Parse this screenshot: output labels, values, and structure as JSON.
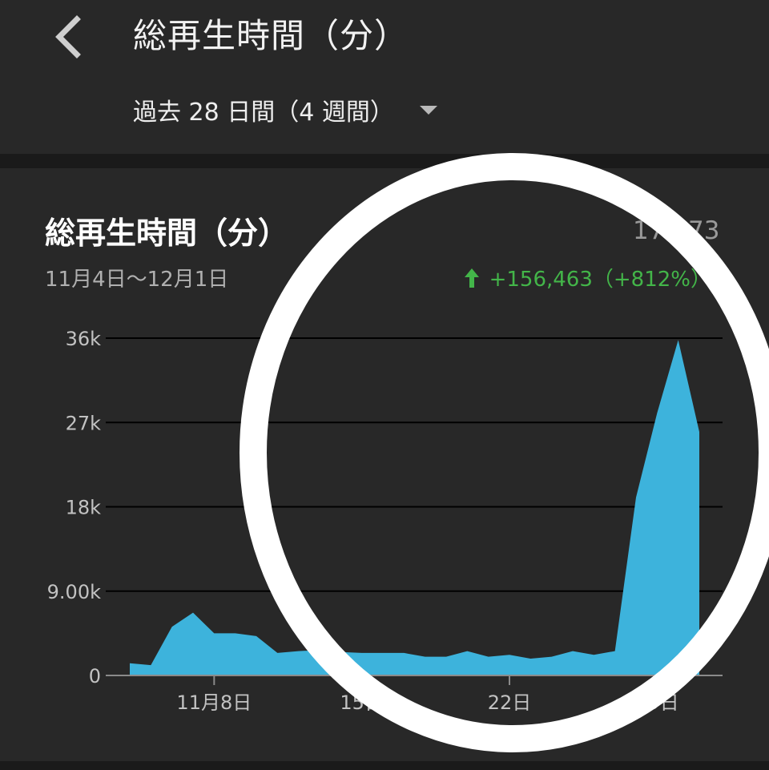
{
  "header": {
    "title": "総再生時間（分）",
    "range_label": "過去 28 日間（4 週間）"
  },
  "card": {
    "title": "総再生時間（分）",
    "total_visible": "175,73",
    "date_range": "11月4日〜12月1日",
    "delta": "+156,463（+812%）"
  },
  "colors": {
    "accent_area": "#3db3dc",
    "positive": "#43b549",
    "highlight_ring": "#ffffff"
  },
  "icons": {
    "back": "chevron-left-icon",
    "dropdown": "caret-down-icon",
    "delta": "arrow-up-icon"
  },
  "chart_data": {
    "type": "area",
    "x_start_label": "11月4日",
    "x_end_label": "12月1日",
    "x_tick_labels": [
      "11月8日",
      "15日",
      "22日",
      "29日"
    ],
    "x_tick_days": [
      8,
      15,
      22,
      29
    ],
    "y_tick_labels": [
      "0",
      "9.00k",
      "18k",
      "27k",
      "36k"
    ],
    "y_tick_values": [
      0,
      9000,
      18000,
      27000,
      36000
    ],
    "ylim": [
      0,
      36000
    ],
    "grid": true,
    "x": [
      4,
      5,
      6,
      7,
      8,
      9,
      10,
      11,
      12,
      13,
      14,
      15,
      16,
      17,
      18,
      19,
      20,
      21,
      22,
      23,
      24,
      25,
      26,
      27,
      28,
      29,
      30,
      31
    ],
    "values": [
      1300,
      1100,
      5200,
      6700,
      4500,
      4500,
      4200,
      2400,
      2600,
      2700,
      2500,
      2400,
      2400,
      2400,
      2000,
      2000,
      2600,
      2000,
      2200,
      1800,
      2000,
      2600,
      2200,
      2600,
      19000,
      28000,
      35800,
      26000
    ]
  }
}
